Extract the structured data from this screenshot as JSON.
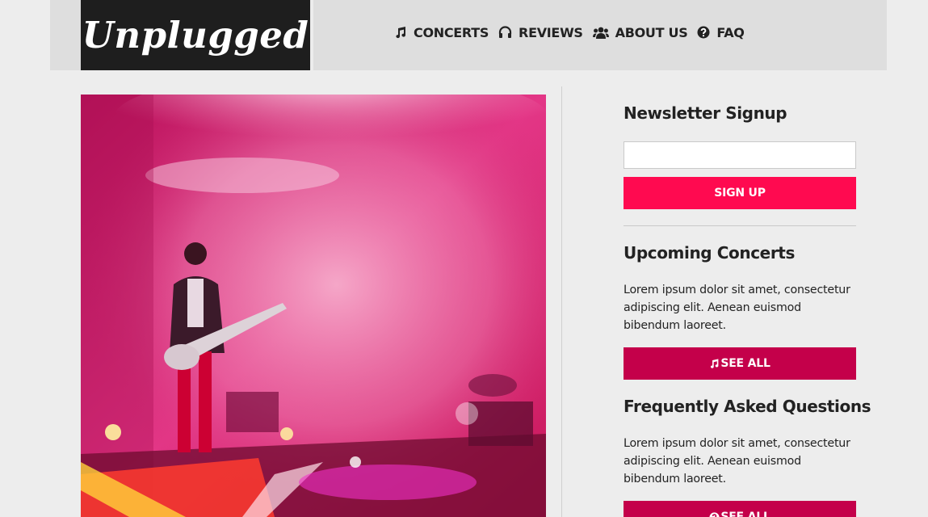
{
  "header": {
    "logo": "Unplugged",
    "nav": [
      {
        "label": "CONCERTS",
        "icon": "music-note-icon"
      },
      {
        "label": "REVIEWS",
        "icon": "headphones-icon"
      },
      {
        "label": "ABOUT US",
        "icon": "users-icon"
      },
      {
        "label": "FAQ",
        "icon": "question-circle-icon"
      }
    ]
  },
  "hero": {
    "image": "concert-guitarist-photo",
    "colors": {
      "base": "#d9206b",
      "haze": "#f6a8c9",
      "stage": "#ff3b2f"
    }
  },
  "sidebar": {
    "newsletter": {
      "title": "Newsletter Signup",
      "input_value": "",
      "input_placeholder": "",
      "button": "SIGN UP"
    },
    "concerts": {
      "title": "Upcoming Concerts",
      "text": "Lorem ipsum dolor sit amet, consectetur adipiscing elit. Aenean euismod bibendum laoreet.",
      "button": "SEE ALL",
      "button_icon": "music-note-icon"
    },
    "faq": {
      "title": "Frequently Asked Questions",
      "text": "Lorem ipsum dolor sit amet, consectetur adipiscing elit. Aenean euismod bibendum laoreet.",
      "button": "SEE ALL",
      "button_icon": "question-circle-icon"
    }
  },
  "colors": {
    "accent": "#ff0a50",
    "accent_dark": "#c4004a",
    "header_bg": "#dedede",
    "logo_bg": "#1e1e1e"
  }
}
